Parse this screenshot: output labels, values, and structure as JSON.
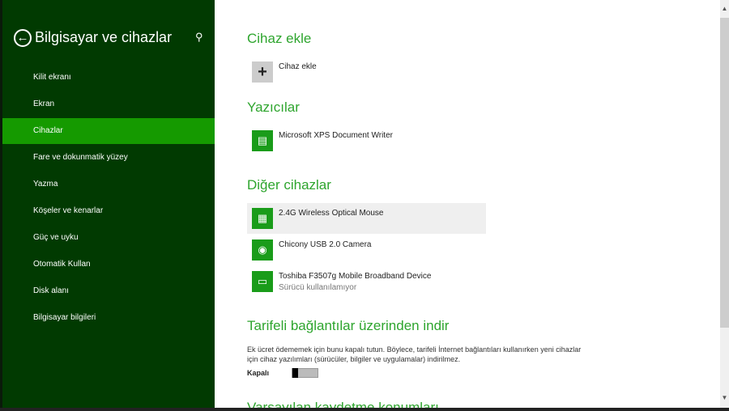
{
  "sidebar": {
    "title": "Bilgisayar ve cihazlar",
    "back_icon": "back-arrow-icon",
    "search_icon": "search-icon",
    "items": [
      {
        "label": "Kilit ekranı"
      },
      {
        "label": "Ekran"
      },
      {
        "label": "Cihazlar",
        "selected": true
      },
      {
        "label": "Fare ve dokunmatik yüzey"
      },
      {
        "label": "Yazma"
      },
      {
        "label": "Köşeler ve kenarlar"
      },
      {
        "label": "Güç ve uyku"
      },
      {
        "label": "Otomatik Kullan"
      },
      {
        "label": "Disk alanı"
      },
      {
        "label": "Bilgisayar bilgileri"
      }
    ]
  },
  "main": {
    "add": {
      "heading": "Cihaz ekle",
      "label": "Cihaz ekle",
      "icon": "+"
    },
    "printers": {
      "heading": "Yazıcılar",
      "items": [
        {
          "label": "Microsoft XPS Document Writer",
          "icon": "printer-icon"
        }
      ]
    },
    "other": {
      "heading": "Diğer cihazlar",
      "items": [
        {
          "label": "2.4G Wireless Optical Mouse",
          "icon": "keyboard-icon"
        },
        {
          "label": "Chicony USB 2.0 Camera",
          "icon": "webcam-icon"
        },
        {
          "label": "Toshiba F3507g Mobile Broadband Device",
          "sub": "Sürücü kullanılamıyor",
          "icon": "devices-icon"
        }
      ]
    },
    "metered": {
      "heading": "Tarifeli bağlantılar üzerinden indir",
      "description": "Ek ücret ödememek için bunu kapalı tutun. Böylece, tarifeli İnternet bağlantıları kullanırken yeni cihazlar için cihaz yazılımları (sürücüler, bilgiler ve uygulamalar) indirilmez.",
      "toggle_label": "Kapalı",
      "toggle_on": false
    },
    "next_heading": "Varsayılan kaydetme konumları"
  },
  "colors": {
    "sidebar": "#013a01",
    "selected": "#159a00",
    "accent": "#2ea52e"
  }
}
